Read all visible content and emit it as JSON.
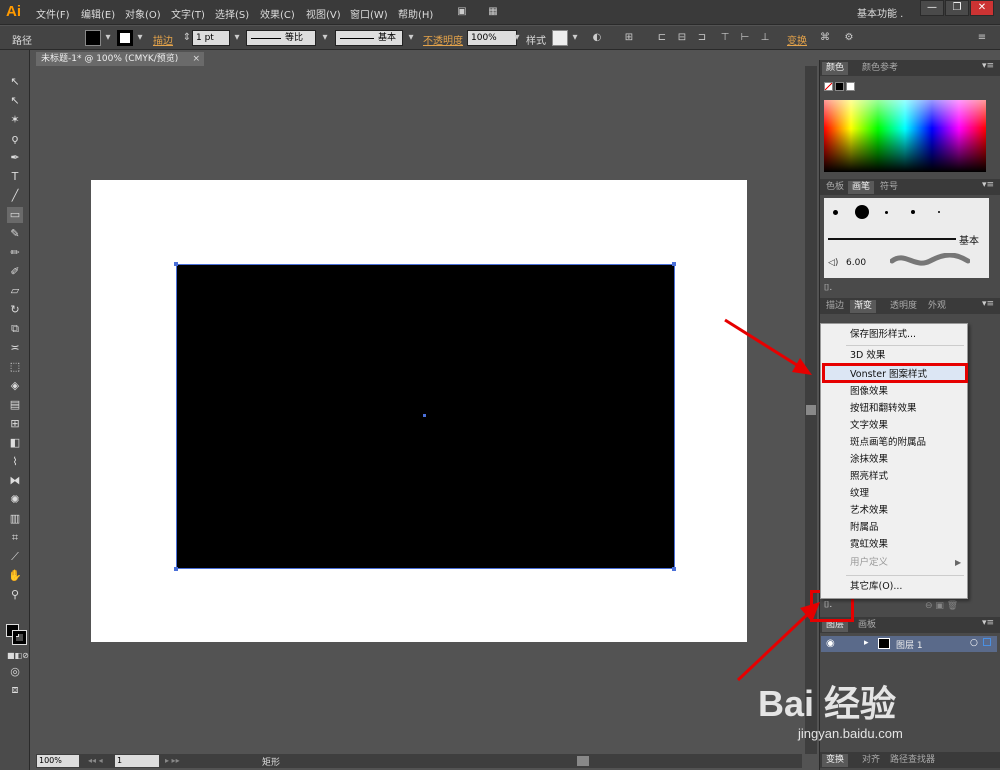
{
  "app": {
    "logo": "Ai",
    "workspace": "基本功能 .",
    "window_controls": [
      "—",
      "❐",
      "✕"
    ]
  },
  "menu": [
    "文件(F)",
    "编辑(E)",
    "对象(O)",
    "文字(T)",
    "选择(S)",
    "效果(C)",
    "视图(V)",
    "窗口(W)",
    "帮助(H)"
  ],
  "control": {
    "object_type": "路径",
    "stroke_label": "描边",
    "stroke_weight": "1 pt",
    "profile_label": "等比",
    "brush_label": "基本",
    "opacity_label": "不透明度",
    "opacity_value": "100%",
    "style_label": "样式",
    "transform_label": "变换"
  },
  "document": {
    "tab_title": "未标题-1* @ 100% (CMYK/预览)",
    "tab_close": "×"
  },
  "status": {
    "zoom": "100%",
    "page": "1",
    "tool": "矩形"
  },
  "panels": {
    "color_tabs": [
      "颜色",
      "颜色参考"
    ],
    "swatch_tabs": [
      "色板",
      "画笔",
      "符号"
    ],
    "brush_base_label": "基本",
    "brush_size": "6.00",
    "appearance_tabs": [
      "描边",
      "渐变",
      "透明度",
      "外观"
    ],
    "layers_tabs": [
      "图层",
      "画板"
    ],
    "layer_name": "图层 1",
    "bottom_tabs": [
      "变换",
      "对齐",
      "路径查找器"
    ],
    "menu_glyph": "▾≡"
  },
  "context_menu": {
    "items": [
      {
        "label": "保存图形样式...",
        "disabled": false
      },
      {
        "label": "3D 效果",
        "disabled": false
      },
      {
        "label": "Vonster 图案样式",
        "disabled": false,
        "highlighted": true
      },
      {
        "label": "图像效果",
        "disabled": false
      },
      {
        "label": "按钮和翻转效果",
        "disabled": false
      },
      {
        "label": "文字效果",
        "disabled": false
      },
      {
        "label": "斑点画笔的附属品",
        "disabled": false
      },
      {
        "label": "涂抹效果",
        "disabled": false
      },
      {
        "label": "照亮样式",
        "disabled": false
      },
      {
        "label": "纹理",
        "disabled": false
      },
      {
        "label": "艺术效果",
        "disabled": false
      },
      {
        "label": "附属品",
        "disabled": false
      },
      {
        "label": "霓虹效果",
        "disabled": false
      },
      {
        "label": "用户定义",
        "disabled": true
      },
      {
        "label": "其它库(O)...",
        "disabled": false
      }
    ]
  },
  "watermark": {
    "brand": "Bai 经验",
    "url": "jingyan.baidu.com"
  },
  "colors": {
    "accent_red": "#e60000",
    "selection_blue": "#4a6fd8",
    "app_orange": "#ff9a00"
  }
}
